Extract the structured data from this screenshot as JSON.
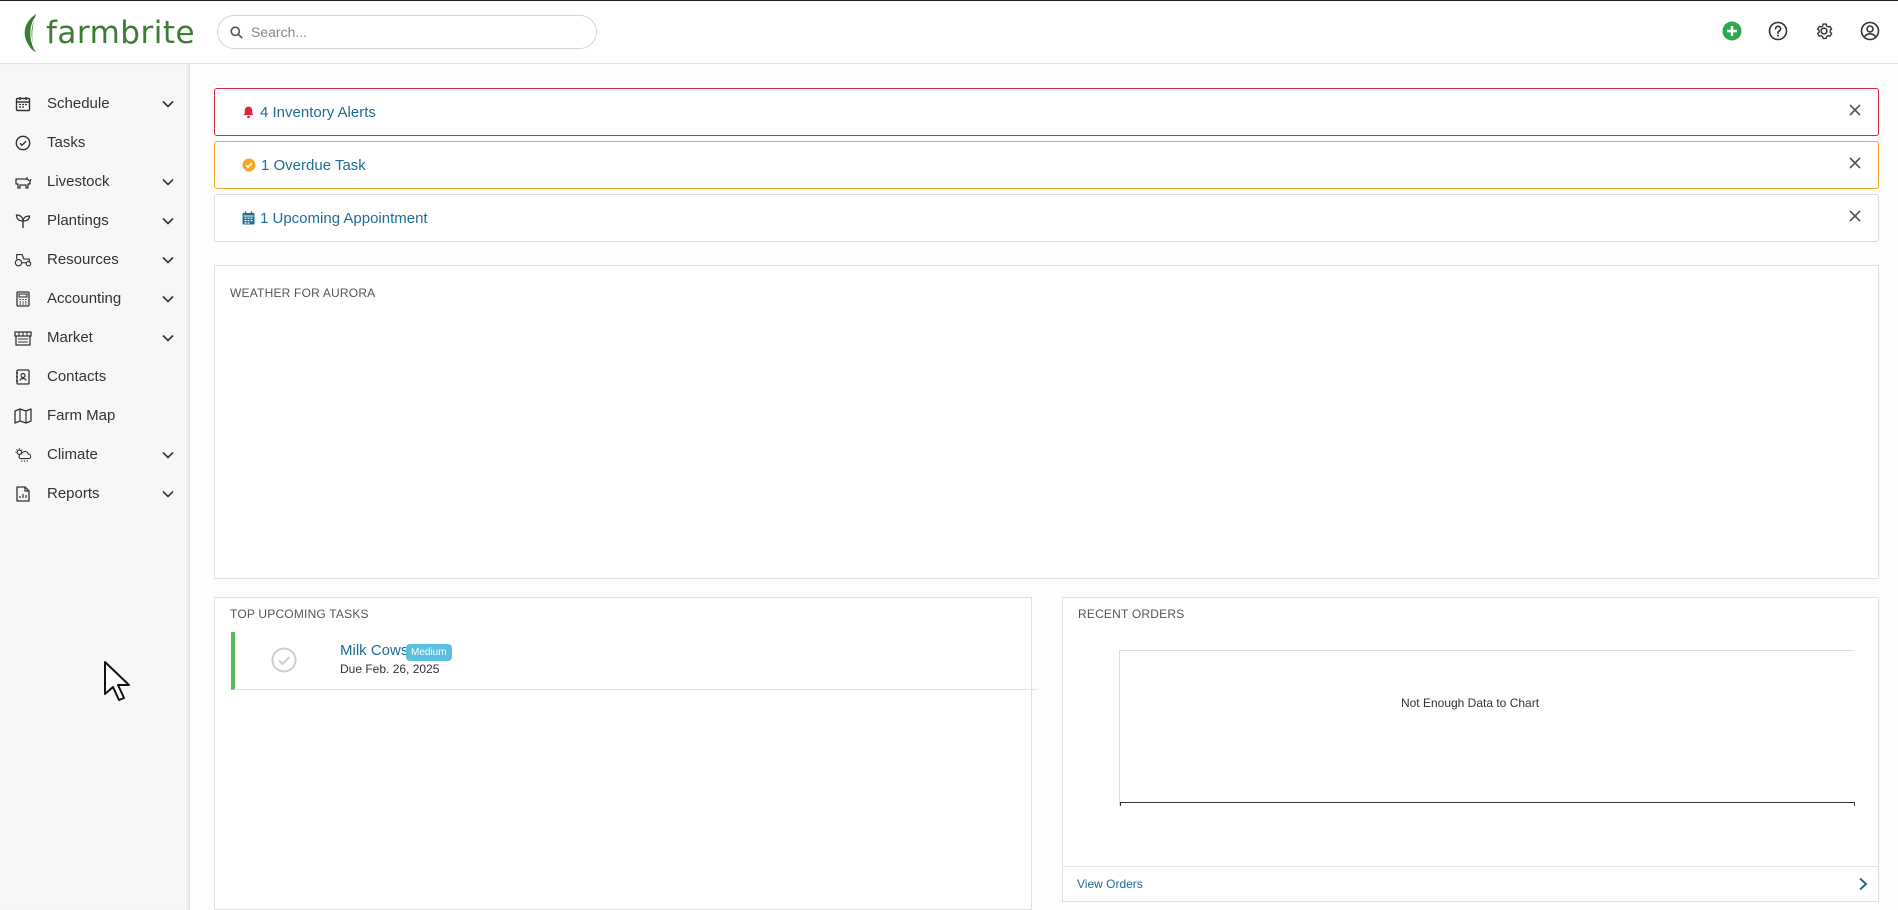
{
  "app": {
    "logo_text": "farmbrite",
    "colors": {
      "brand_green": "#3a7d33",
      "link_blue": "#1e6d93",
      "alert_red": "#e0233f",
      "alert_orange": "#f5a623",
      "task_green": "#5cb85c",
      "badge_blue": "#5bc0de"
    }
  },
  "search": {
    "placeholder": "Search...",
    "value": ""
  },
  "topbar_icons": [
    "add-circle-icon",
    "help-icon",
    "settings-gear-icon",
    "user-account-icon"
  ],
  "sidebar": {
    "items": [
      {
        "label": "Schedule",
        "icon": "calendar-icon",
        "expandable": true
      },
      {
        "label": "Tasks",
        "icon": "check-circle-icon",
        "expandable": false
      },
      {
        "label": "Livestock",
        "icon": "cow-icon",
        "expandable": true
      },
      {
        "label": "Plantings",
        "icon": "sprout-icon",
        "expandable": true
      },
      {
        "label": "Resources",
        "icon": "tractor-icon",
        "expandable": true
      },
      {
        "label": "Accounting",
        "icon": "calculator-icon",
        "expandable": true
      },
      {
        "label": "Market",
        "icon": "market-stall-icon",
        "expandable": true
      },
      {
        "label": "Contacts",
        "icon": "contacts-book-icon",
        "expandable": false
      },
      {
        "label": "Farm Map",
        "icon": "map-icon",
        "expandable": false
      },
      {
        "label": "Climate",
        "icon": "weather-icon",
        "expandable": true
      },
      {
        "label": "Reports",
        "icon": "report-icon",
        "expandable": true
      }
    ]
  },
  "alerts": [
    {
      "text": "4 Inventory Alerts",
      "icon": "bell-icon",
      "color": "#e0233f"
    },
    {
      "text": "1 Overdue Task",
      "icon": "check-circle-icon",
      "color": "#f5a623"
    },
    {
      "text": "1 Upcoming Appointment",
      "icon": "calendar-icon",
      "color": "#1e6d93"
    }
  ],
  "weather": {
    "title": "WEATHER FOR AURORA"
  },
  "tasks_panel": {
    "title": "TOP UPCOMING TASKS",
    "tasks": [
      {
        "name": "Milk Cows",
        "priority": "Medium",
        "due": "Due Feb. 26, 2025"
      }
    ]
  },
  "orders_panel": {
    "title": "RECENT ORDERS",
    "empty_message": "Not Enough Data to Chart",
    "link_label": "View Orders"
  }
}
